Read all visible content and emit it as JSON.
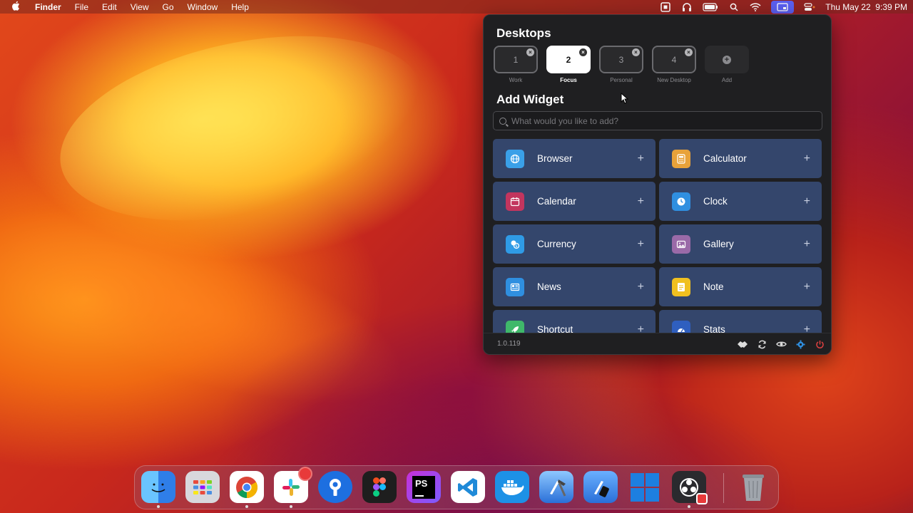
{
  "menubar": {
    "app_name": "Finder",
    "menus": [
      "File",
      "Edit",
      "View",
      "Go",
      "Window",
      "Help"
    ],
    "datetime": "Thu May 22  9:39 PM",
    "status_icons": [
      "screen-record-icon",
      "headphones-icon",
      "battery-icon",
      "search-icon",
      "wifi-icon",
      "desktops-app-icon",
      "control-center-icon"
    ]
  },
  "panel": {
    "desktops_title": "Desktops",
    "desktops": [
      {
        "number": "1",
        "label": "Work",
        "active": false
      },
      {
        "number": "2",
        "label": "Focus",
        "active": true
      },
      {
        "number": "3",
        "label": "Personal",
        "active": false
      },
      {
        "number": "4",
        "label": "New Desktop",
        "active": false
      }
    ],
    "add_label": "Add",
    "add_widget_title": "Add Widget",
    "search_placeholder": "What would you like to add?",
    "widgets": [
      {
        "label": "Browser",
        "icon": "globe-icon",
        "color": "#3aa0e8"
      },
      {
        "label": "Calculator",
        "icon": "calculator-icon",
        "color": "#e8a23a"
      },
      {
        "label": "Calendar",
        "icon": "calendar-icon",
        "color": "#c2355e"
      },
      {
        "label": "Clock",
        "icon": "clock-icon",
        "color": "#2f8fe0"
      },
      {
        "label": "Currency",
        "icon": "currency-icon",
        "color": "#2f9be6"
      },
      {
        "label": "Gallery",
        "icon": "gallery-icon",
        "color": "#9a6aa8"
      },
      {
        "label": "News",
        "icon": "news-icon",
        "color": "#2f8fe0"
      },
      {
        "label": "Note",
        "icon": "note-icon",
        "color": "#f0c020"
      },
      {
        "label": "Shortcut",
        "icon": "rocket-icon",
        "color": "#3fb86a"
      },
      {
        "label": "Stats",
        "icon": "stats-icon",
        "color": "#2f5fbf"
      }
    ],
    "version": "1.0.119",
    "footer_icons": [
      "handshake-icon",
      "refresh-icon",
      "eye-icon",
      "gear-icon",
      "power-icon"
    ]
  },
  "dock": {
    "apps": [
      {
        "name": "finder-app",
        "color": "#3b8ef0",
        "running": true
      },
      {
        "name": "launchpad-app",
        "color": "#d8d8dc",
        "running": false
      },
      {
        "name": "chrome-app",
        "color": "#ffffff",
        "running": true
      },
      {
        "name": "slack-app",
        "color": "#ffffff",
        "running": true
      },
      {
        "name": "sourcetree-app",
        "color": "#1d6fe0",
        "running": false
      },
      {
        "name": "figma-app",
        "color": "#1e1e1e",
        "running": false
      },
      {
        "name": "phpstorm-app",
        "color": "#c82fd8",
        "running": false
      },
      {
        "name": "vscode-app",
        "color": "#ffffff",
        "running": false
      },
      {
        "name": "docker-app",
        "color": "#1d91e6",
        "running": false
      },
      {
        "name": "xcode-app",
        "color": "#4a90e8",
        "running": false
      },
      {
        "name": "simulator-app",
        "color": "#3a8de8",
        "running": false
      },
      {
        "name": "windows-app",
        "color": "#1d7fe0",
        "running": false
      },
      {
        "name": "obs-app",
        "color": "#2a2a2e",
        "running": true
      }
    ],
    "trash": "trash-icon"
  }
}
